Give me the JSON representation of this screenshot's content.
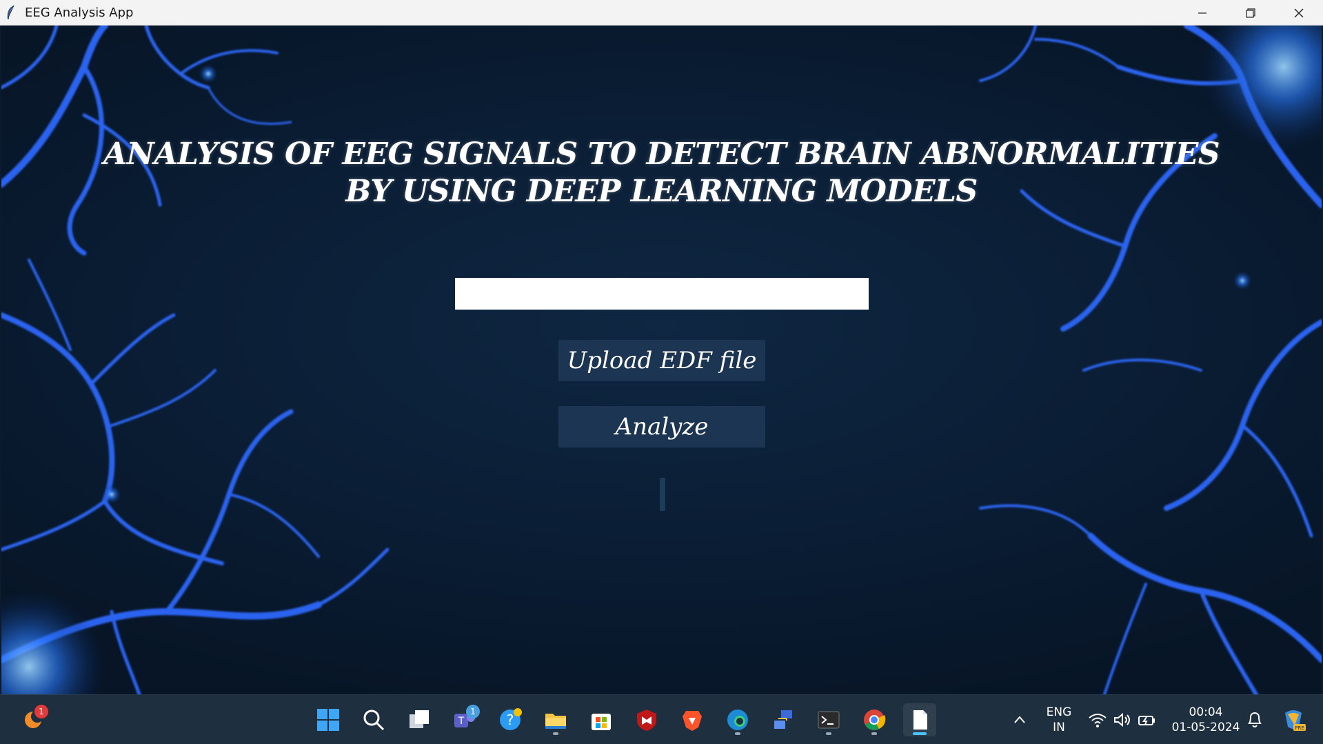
{
  "window": {
    "title": "EEG Analysis App"
  },
  "app": {
    "headline_line1": "ANALYSIS OF EEG SIGNALS TO DETECT BRAIN ABNORMALITIES",
    "headline_line2": "BY USING DEEP LEARNING MODELS",
    "file_path_value": "",
    "upload_label": "Upload EDF file",
    "analyze_label": "Analyze"
  },
  "taskbar": {
    "weather_badge": "1",
    "teams_badge": "1",
    "icons": [
      "weather-icon",
      "start-icon",
      "search-icon",
      "task-view-icon",
      "teams-icon",
      "help-icon",
      "file-explorer-icon",
      "store-icon",
      "mcafee-icon",
      "brave-icon",
      "edge-icon",
      "network-app-icon",
      "terminal-icon",
      "chrome-icon",
      "notepad-icon",
      "copilot-icon"
    ],
    "language_top": "ENG",
    "language_bottom": "IN",
    "time": "00:04",
    "date": "01-05-2024"
  },
  "colors": {
    "background": "#0b1a2e",
    "button": "#1c3553",
    "vein": "#2f6bff",
    "taskbar": "#1e2f3f",
    "accent": "#4cc2ff"
  }
}
